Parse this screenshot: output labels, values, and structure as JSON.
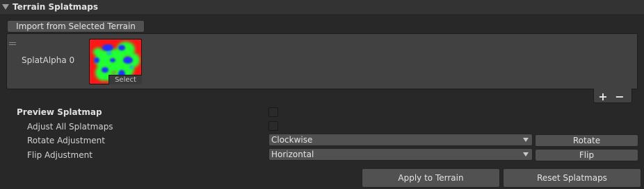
{
  "header": {
    "title": "Terrain Splatmaps"
  },
  "toolbar": {
    "import_label": "Import from Selected Terrain"
  },
  "splat_list": {
    "items": [
      {
        "label": "SplatAlpha 0",
        "select_label": "Select"
      }
    ],
    "add_label": "+",
    "remove_label": "−"
  },
  "preview": {
    "label": "Preview Splatmap",
    "checked": false
  },
  "adjust_all": {
    "label": "Adjust All Splatmaps",
    "checked": false
  },
  "rotate": {
    "label": "Rotate Adjustment",
    "value": "Clockwise",
    "button_label": "Rotate"
  },
  "flip": {
    "label": "Flip Adjustment",
    "value": "Horizontal",
    "button_label": "Flip"
  },
  "actions": {
    "apply_label": "Apply to Terrain",
    "reset_label": "Reset Splatmaps"
  },
  "colors": {
    "background": "#282828",
    "header": "#333333",
    "button": "#515151",
    "splat_red": "#ff1a1a",
    "splat_green": "#22ff33",
    "splat_blue": "#1c33ff"
  }
}
